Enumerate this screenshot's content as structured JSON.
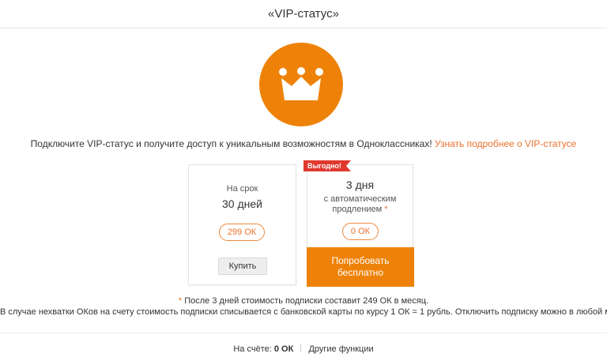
{
  "header": {
    "title": "«VIP-статус»"
  },
  "intro": {
    "text": "Подключите VIP-статус и получите доступ к уникальным возможностям в Одноклассниках! ",
    "link": "Узнать подробнее о VIP-статусе"
  },
  "plans": {
    "monthly": {
      "caption": "На срок",
      "period": "30 дней",
      "price": "299 ОК",
      "button": "Купить"
    },
    "trial": {
      "badge": "Выгодно!",
      "period": "3 дня",
      "caption_line1": "с автоматическим",
      "caption_line2": "продлением",
      "asterisk": "*",
      "price": "0 ОК",
      "button_line1": "Попробовать",
      "button_line2": "бесплатно"
    }
  },
  "notes": {
    "asterisk": "*",
    "line1": " После 3 дней стоимость подписки составит 249 ОК в месяц.",
    "line2": "В случае нехватки ОКов на счету стоимость подписки списывается с банковской карты по курсу 1 ОК = 1 рубль. Отключить подписку можно в любой момент."
  },
  "footer": {
    "balance_label": "На счёте:",
    "balance_value": "0 ОК",
    "other_link": "Другие функции"
  },
  "colors": {
    "accent": "#ee8208",
    "link": "#eb722e",
    "badge": "#e0382e"
  },
  "icons": {
    "hero": "crown-icon"
  }
}
